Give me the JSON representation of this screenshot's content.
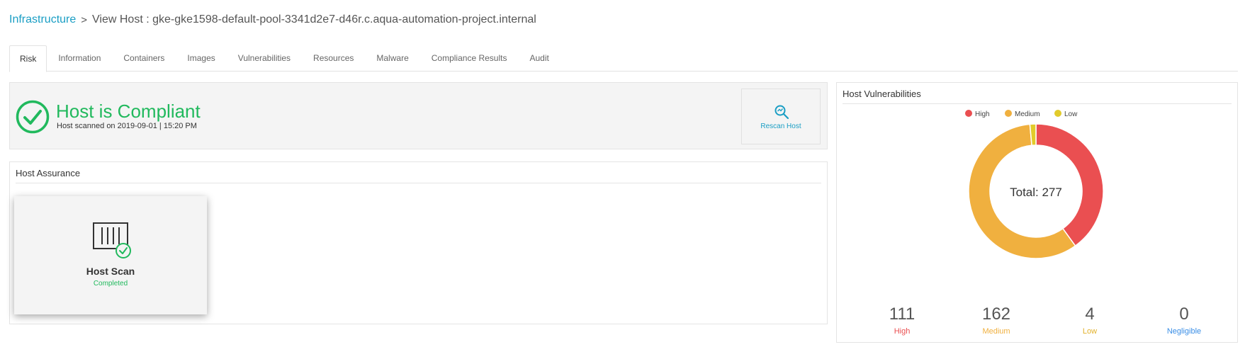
{
  "breadcrumb": {
    "link": "Infrastructure",
    "separator": ">",
    "current": "View Host : gke-gke1598-default-pool-3341d2e7-d46r.c.aqua-automation-project.internal"
  },
  "tabs": [
    {
      "label": "Risk",
      "active": true
    },
    {
      "label": "Information"
    },
    {
      "label": "Containers"
    },
    {
      "label": "Images"
    },
    {
      "label": "Vulnerabilities"
    },
    {
      "label": "Resources"
    },
    {
      "label": "Malware"
    },
    {
      "label": "Compliance Results"
    },
    {
      "label": "Audit"
    }
  ],
  "compliance": {
    "title": "Host is Compliant",
    "scanned": "Host scanned on 2019-09-01 | 15:20 PM",
    "rescan_label": "Rescan Host",
    "status_color": "#21b95d"
  },
  "assurance": {
    "title": "Host Assurance",
    "card_title": "Host Scan",
    "card_status": "Completed"
  },
  "vulnerabilities": {
    "title": "Host Vulnerabilities",
    "total_label": "Total: 277",
    "legend": [
      {
        "label": "High",
        "color": "#ea4f51"
      },
      {
        "label": "Medium",
        "color": "#f0b03f"
      },
      {
        "label": "Low",
        "color": "#e2cb2b"
      }
    ],
    "stats": [
      {
        "value": "111",
        "label": "High",
        "color": "#ea4f51"
      },
      {
        "value": "162",
        "label": "Medium",
        "color": "#f0b03f"
      },
      {
        "value": "4",
        "label": "Low",
        "color": "#e2b12b"
      },
      {
        "value": "0",
        "label": "Negligible",
        "color": "#3a8ee6"
      }
    ]
  },
  "chart_data": {
    "type": "pie",
    "categories": [
      "High",
      "Medium",
      "Low"
    ],
    "values": [
      111,
      162,
      4
    ],
    "colors": [
      "#ea4f51",
      "#f0b03f",
      "#e2cb2b"
    ],
    "legend": "top-center"
  }
}
